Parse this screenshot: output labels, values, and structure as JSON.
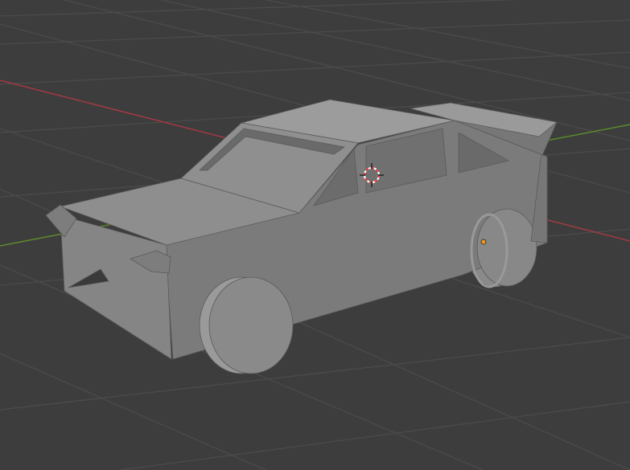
{
  "viewport": {
    "background_color": "#3d3d3d",
    "grid_color": "#4a4a4a",
    "x_axis_color": "#a23a45",
    "y_axis_color": "#5b8a2c"
  },
  "object": {
    "selected": false,
    "origin_color": "#f19a1c"
  },
  "cursor_3d": {
    "ring_colors": [
      "#ff3b3b",
      "#ffffff"
    ]
  }
}
